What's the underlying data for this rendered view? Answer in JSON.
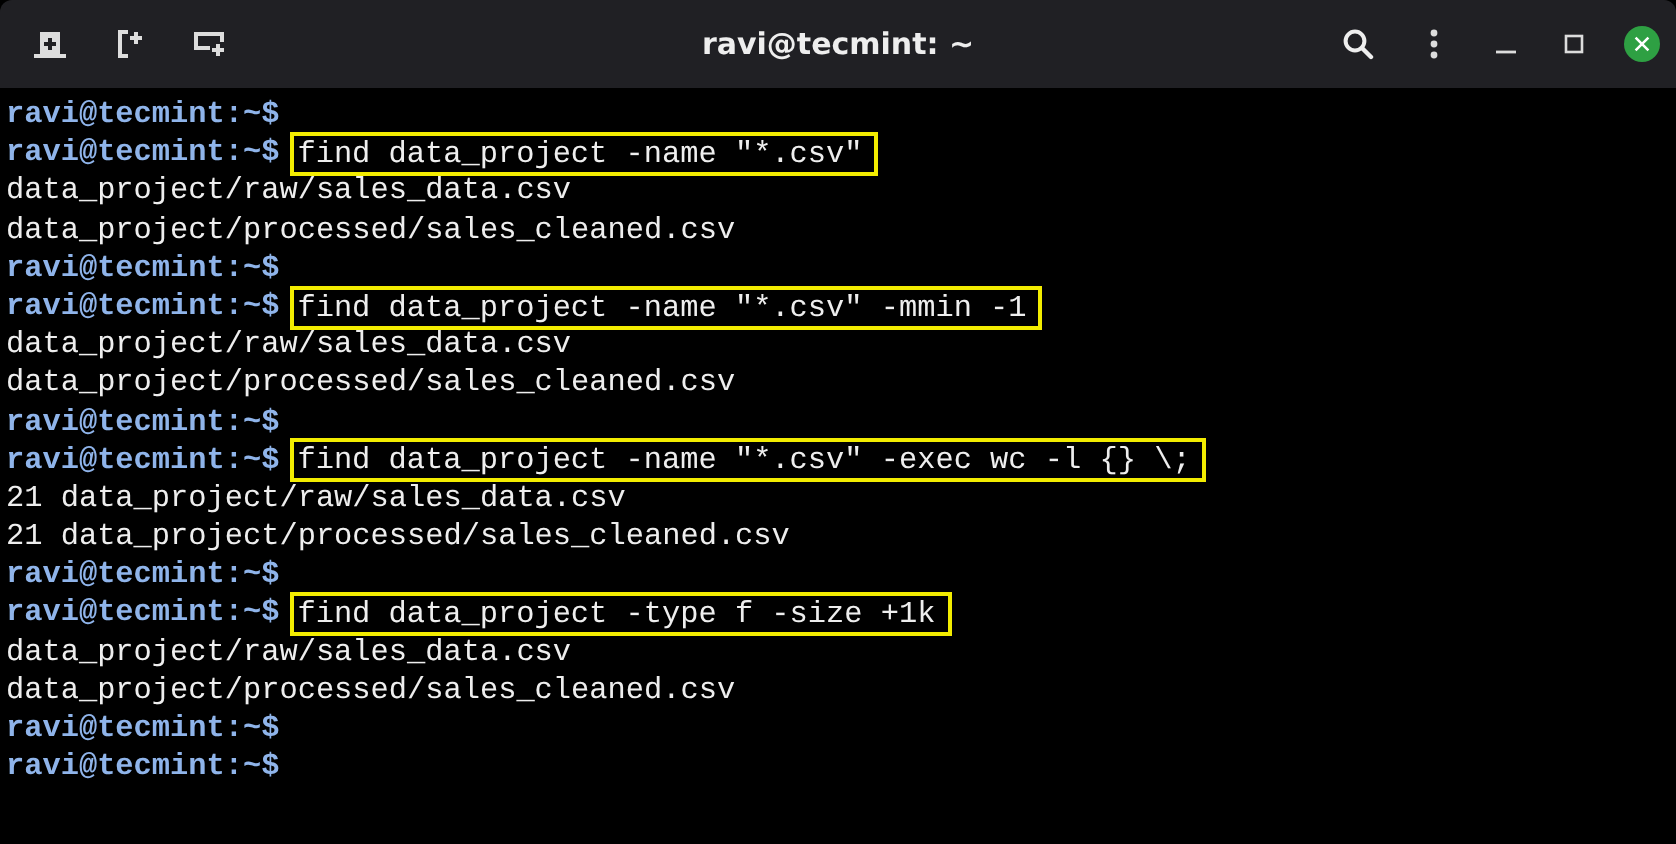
{
  "window": {
    "title": "ravi@tecmint: ~"
  },
  "terminal": {
    "lines": [
      {
        "kind": "prompt",
        "prompt": "ravi@tecmint:~$"
      },
      {
        "kind": "prompt",
        "prompt": "ravi@tecmint:~$",
        "command": "find data_project -name \"*.csv\"",
        "highlighted": true
      },
      {
        "kind": "output",
        "text": "data_project/raw/sales_data.csv"
      },
      {
        "kind": "output",
        "text": "data_project/processed/sales_cleaned.csv"
      },
      {
        "kind": "prompt",
        "prompt": "ravi@tecmint:~$"
      },
      {
        "kind": "prompt",
        "prompt": "ravi@tecmint:~$",
        "command": "find data_project -name \"*.csv\" -mmin -1",
        "highlighted": true
      },
      {
        "kind": "output",
        "text": "data_project/raw/sales_data.csv"
      },
      {
        "kind": "output",
        "text": "data_project/processed/sales_cleaned.csv"
      },
      {
        "kind": "prompt",
        "prompt": "ravi@tecmint:~$"
      },
      {
        "kind": "prompt",
        "prompt": "ravi@tecmint:~$",
        "command": "find data_project -name \"*.csv\" -exec wc -l {} \\;",
        "highlighted": true
      },
      {
        "kind": "output",
        "text": "21 data_project/raw/sales_data.csv"
      },
      {
        "kind": "output",
        "text": "21 data_project/processed/sales_cleaned.csv"
      },
      {
        "kind": "prompt",
        "prompt": "ravi@tecmint:~$"
      },
      {
        "kind": "prompt",
        "prompt": "ravi@tecmint:~$",
        "command": "find data_project -type f -size +1k",
        "highlighted": true
      },
      {
        "kind": "output",
        "text": "data_project/raw/sales_data.csv"
      },
      {
        "kind": "output",
        "text": "data_project/processed/sales_cleaned.csv"
      },
      {
        "kind": "prompt",
        "prompt": "ravi@tecmint:~$"
      },
      {
        "kind": "prompt",
        "prompt": "ravi@tecmint:~$"
      }
    ]
  }
}
